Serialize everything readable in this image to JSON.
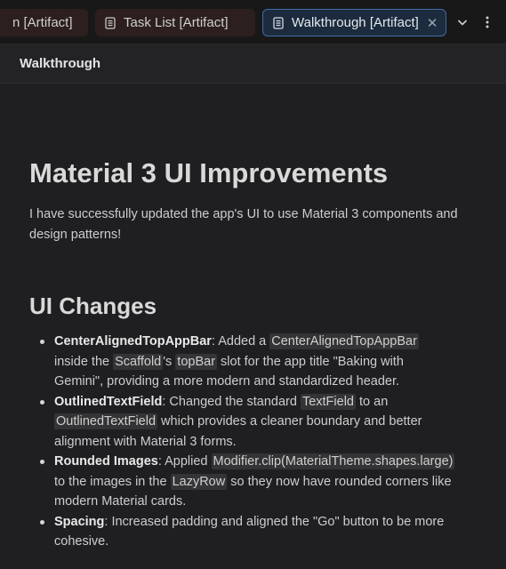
{
  "tabs": [
    {
      "label": "n [Artifact]"
    },
    {
      "label": "Task List [Artifact]"
    },
    {
      "label": "Walkthrough [Artifact]",
      "active": true
    }
  ],
  "tab_close_glyph": "✕",
  "header": {
    "title": "Walkthrough"
  },
  "doc": {
    "title": "Material 3 UI Improvements",
    "intro": "I have successfully updated the app's UI to use Material 3 components and design patterns!",
    "section_heading": "UI Changes",
    "items": [
      {
        "name": "CenterAlignedTopAppBar",
        "t1": ": Added a ",
        "c1": "CenterAlignedTopAppBar",
        "t2": " inside the ",
        "c2": "Scaffold",
        "t3": "'s ",
        "c3": "topBar",
        "t4": " slot for the app title \"Baking with Gemini\", providing a more modern and standardized header."
      },
      {
        "name": "OutlinedTextField",
        "t1": ": Changed the standard ",
        "c1": "TextField",
        "t2": " to an ",
        "c2": "OutlinedTextField",
        "t3": " which provides a cleaner boundary and better alignment with Material 3 forms."
      },
      {
        "name": "Rounded Images",
        "t1": ": Applied ",
        "c1": "Modifier.clip(MaterialTheme.shapes.large)",
        "t2": " to the images in the ",
        "c2": "LazyRow",
        "t3": " so they now have rounded corners like modern Material cards."
      },
      {
        "name": "Spacing",
        "t1": ": Increased padding and aligned the \"Go\" button to be more cohesive."
      }
    ]
  },
  "icons": [
    "doc-icon",
    "close-icon",
    "chevron-down-icon",
    "more-vertical-icon"
  ],
  "colors": {
    "background": "#1f1f22",
    "active_tab_border": "#3e6ea6",
    "active_tab_bg": "#1c2b3d",
    "inactive_tab_bg": "#2c1f1d"
  }
}
